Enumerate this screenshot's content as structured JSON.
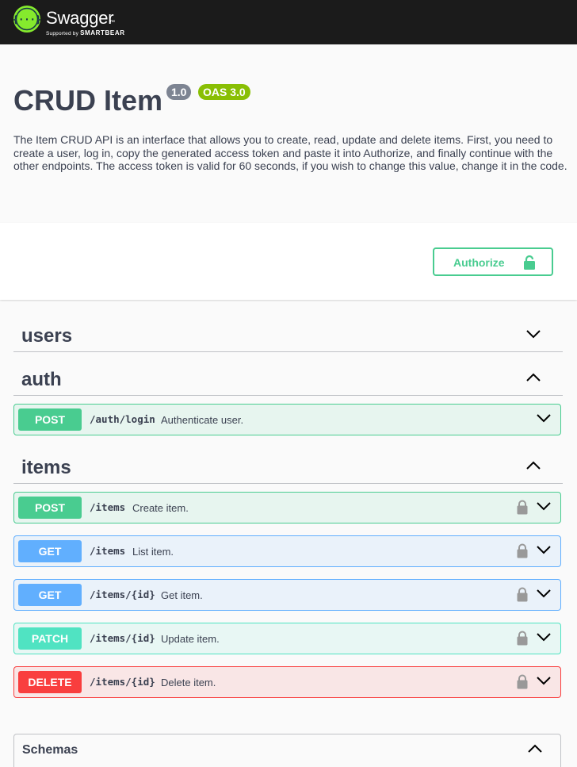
{
  "topbar": {
    "logo_text": "Swagger",
    "logo_tm": "™",
    "logo_sub_prefix": "Supported by",
    "logo_sub_brand": "SMARTBEAR",
    "logo_icon": "swagger-logo-icon"
  },
  "info": {
    "title": "CRUD Item",
    "version": "1.0",
    "oas": "OAS 3.0",
    "description": "The Item CRUD API is an interface that allows you to create, read, update and delete items. First, you need to create a user, log in, copy the generated access token and paste it into Authorize, and finally continue with the other endpoints. The access token is valid for 60 seconds, if you wish to change this value, change it in the code."
  },
  "scheme": {
    "authorize_label": "Authorize"
  },
  "tags": {
    "users": {
      "name": "users",
      "state": "collapsed"
    },
    "auth": {
      "name": "auth",
      "state": "expanded"
    },
    "items": {
      "name": "items",
      "state": "expanded"
    }
  },
  "operations": {
    "auth_login": {
      "method": "POST",
      "path": "/auth/login",
      "summary": "Authenticate user."
    },
    "items_create": {
      "method": "POST",
      "path": "/items",
      "summary": "Create item."
    },
    "items_list": {
      "method": "GET",
      "path": "/items",
      "summary": "List item."
    },
    "items_get": {
      "method": "GET",
      "path": "/items/{id}",
      "summary": "Get item."
    },
    "items_update": {
      "method": "PATCH",
      "path": "/items/{id}",
      "summary": "Update item."
    },
    "items_delete": {
      "method": "DELETE",
      "path": "/items/{id}",
      "summary": "Delete item."
    }
  },
  "schemas": {
    "title": "Schemas"
  },
  "colors": {
    "post": "#49cc90",
    "get": "#61affe",
    "patch": "#50e3c2",
    "delete": "#f93e3e",
    "topbar": "#1b1b1b",
    "logo": "#85ea2d",
    "version_badge": "#7d8492",
    "oas_badge": "#89bf04"
  }
}
